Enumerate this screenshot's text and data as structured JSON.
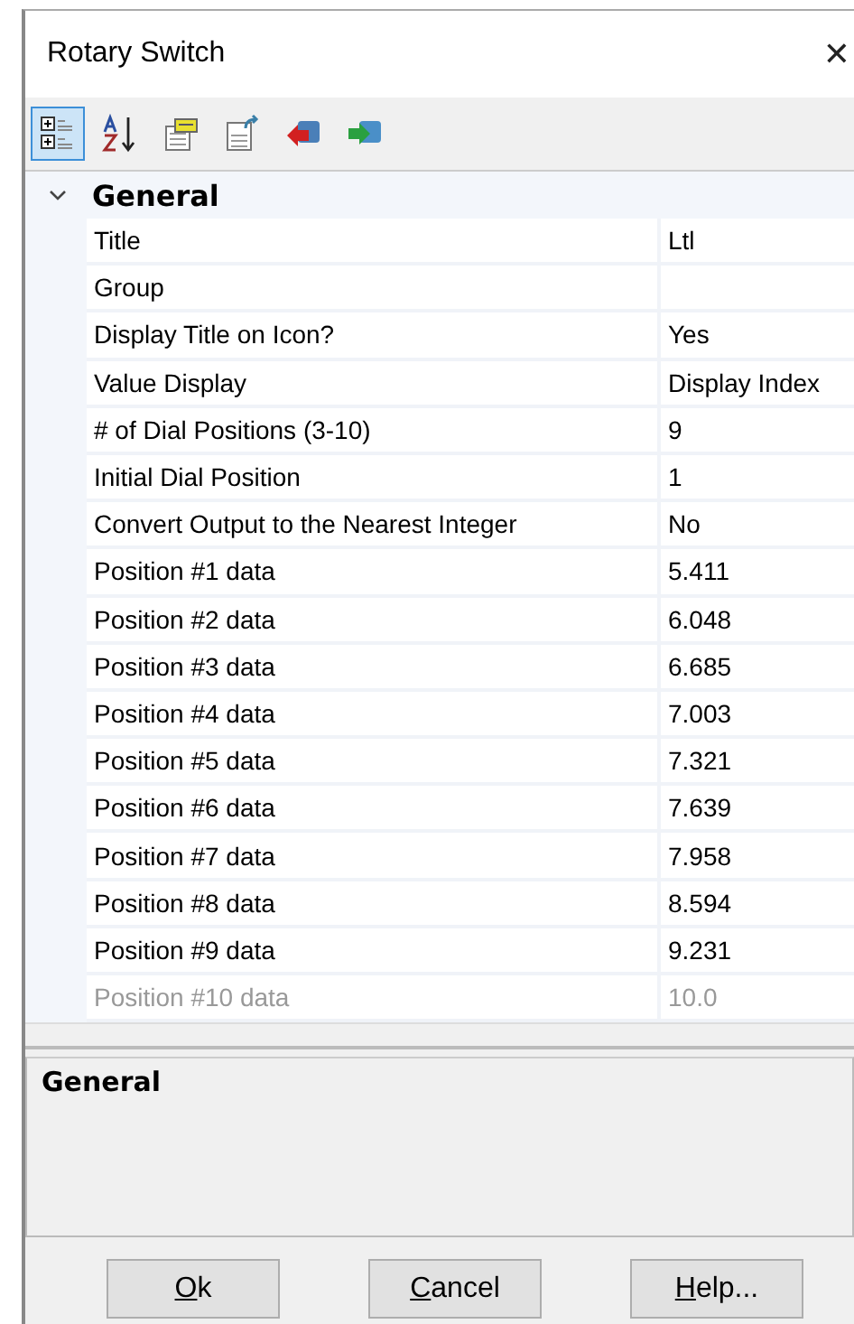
{
  "window": {
    "title": "Rotary Switch",
    "close": "✕"
  },
  "toolbar": [
    {
      "kind": "categorized",
      "selected": true
    },
    {
      "kind": "alphabetical",
      "selected": false
    },
    {
      "kind": "property-pages",
      "selected": false
    },
    {
      "kind": "export",
      "selected": false
    },
    {
      "kind": "back",
      "selected": false
    },
    {
      "kind": "forward",
      "selected": false
    }
  ],
  "grid": {
    "category": {
      "label": "General",
      "expanded": true
    },
    "rows": [
      {
        "name": "Title",
        "value": "Ltl",
        "disabled": false
      },
      {
        "name": "Group",
        "value": null,
        "disabled": false
      },
      {
        "name": "Display Title on Icon?",
        "value": "Yes",
        "disabled": false
      },
      {
        "name": "Value Display",
        "value": "Display Index",
        "disabled": false
      },
      {
        "name": "# of Dial Positions (3-10)",
        "value": "9",
        "disabled": false
      },
      {
        "name": "Initial Dial Position",
        "value": "1",
        "disabled": false
      },
      {
        "name": "Convert Output to the Nearest Integer",
        "value": "No",
        "disabled": false
      },
      {
        "name": "Position #1 data",
        "value": "5.411",
        "disabled": false
      },
      {
        "name": "Position #2 data",
        "value": "6.048",
        "disabled": false
      },
      {
        "name": "Position #3 data",
        "value": "6.685",
        "disabled": false
      },
      {
        "name": "Position #4 data",
        "value": "7.003",
        "disabled": false
      },
      {
        "name": "Position #5 data",
        "value": "7.321",
        "disabled": false
      },
      {
        "name": "Position #6 data",
        "value": "7.639",
        "disabled": false
      },
      {
        "name": "Position #7 data",
        "value": "7.958",
        "disabled": false
      },
      {
        "name": "Position #8 data",
        "value": "8.594",
        "disabled": false
      },
      {
        "name": "Position #9 data",
        "value": "9.231",
        "disabled": false
      },
      {
        "name": "Position #10 data",
        "value": "10.0",
        "disabled": true
      }
    ]
  },
  "description": {
    "title": "General"
  },
  "buttons": [
    {
      "mnemonic": "O",
      "rest": "k"
    },
    {
      "mnemonic": "C",
      "rest": "ancel"
    },
    {
      "mnemonic": "H",
      "rest": "elp..."
    }
  ]
}
